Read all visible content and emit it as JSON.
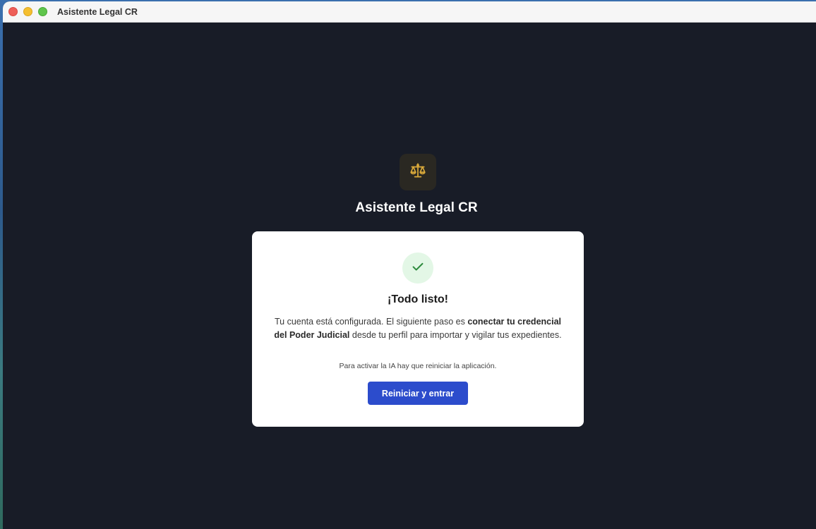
{
  "window": {
    "title": "Asistente Legal CR"
  },
  "brand": {
    "name": "Asistente Legal CR",
    "icon": "scales-icon",
    "icon_color": "#d9a93a"
  },
  "card": {
    "status_icon": "check-icon",
    "title": "¡Todo listo!",
    "text_part1": "Tu cuenta está configurada. El siguiente paso es ",
    "text_bold1": "conectar tu credencial del Poder Judicial",
    "text_part2": " desde tu perfil para importar y vigilar tus expedientes.",
    "note": "Para activar la IA hay que reiniciar la aplicación.",
    "button_label": "Reiniciar y entrar"
  },
  "colors": {
    "background": "#181c27",
    "accent": "#2c4ccc",
    "success": "#2e8b3e"
  }
}
